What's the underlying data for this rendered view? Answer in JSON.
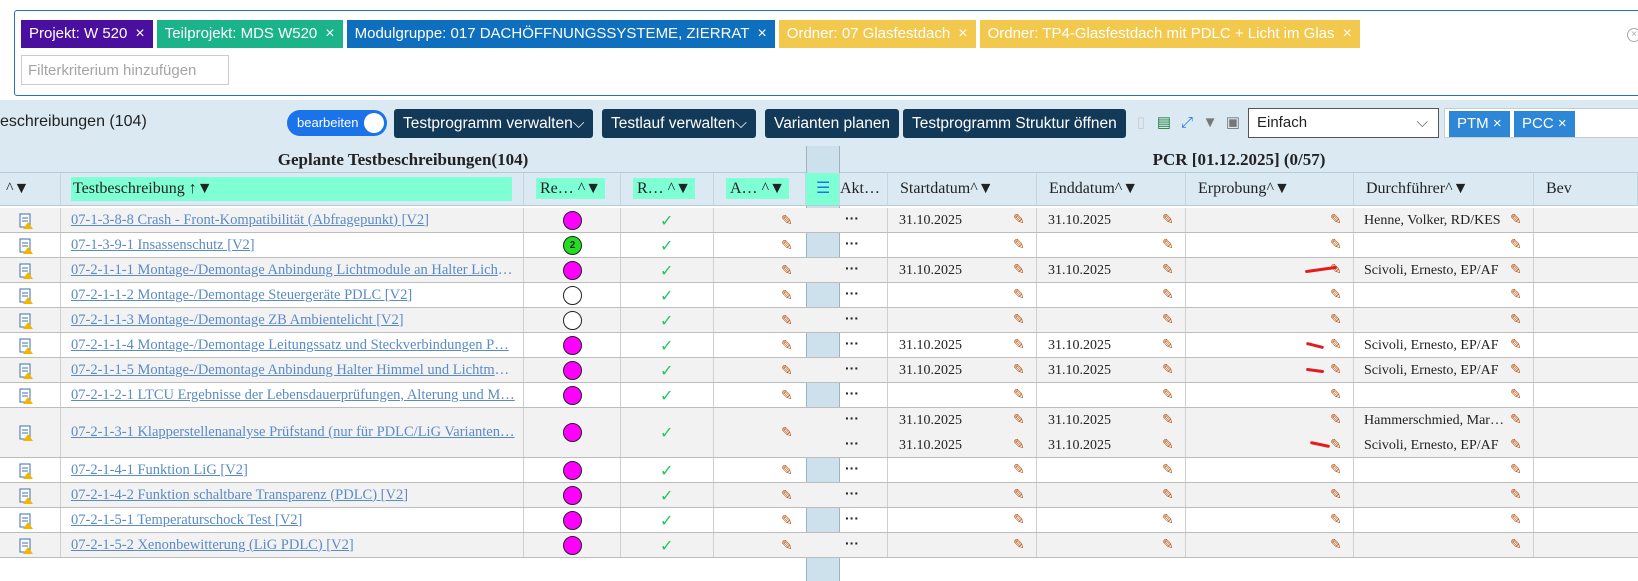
{
  "filters": {
    "chips": [
      {
        "label": "Projekt: W 520",
        "color": "#4b0fa0"
      },
      {
        "label": "Teilprojekt: MDS W520",
        "color": "#1bb38a"
      },
      {
        "label": "Modulgruppe: 017 DACHÖFFNUNGSSYSTEME, ZIERRAT",
        "color": "#0d6fbd"
      },
      {
        "label": "Ordner: 07 Glasfestdach",
        "color": "#f3c94d"
      },
      {
        "label": "Ordner: TP4-Glasfestdach mit PDLC + Licht im Glas",
        "color": "#f3c94d"
      }
    ],
    "remove_glyph": "×",
    "placeholder": "Filterkriterium hinzufügen"
  },
  "toolbar": {
    "title": "eschreibungen (104)",
    "toggle_label": "bearbeiten",
    "buttons": [
      "Testprogramm verwalten",
      "Testlauf verwalten",
      "Varianten planen",
      "Testprogramm Struktur öffnen"
    ],
    "select_value": "Einfach",
    "tags": [
      "PTM",
      "PCC"
    ]
  },
  "grid": {
    "group_left": "Geplante Testbeschreibungen(104)",
    "group_right": "PCR [01.12.2025] (0/57)",
    "columns_left": [
      "Testbeschreibung",
      "Re…",
      "R…",
      "A…"
    ],
    "columns_right": [
      "Akt…",
      "Startdatum",
      "Enddatum",
      "Erprobung",
      "Durchführer",
      "Bev"
    ],
    "rows": [
      {
        "name": "07-1-3-8-8 Crash - Front-Kompatibilität (Abfragepunkt) [V2]",
        "status": "magenta",
        "start": "31.10.2025",
        "end": "31.10.2025",
        "person": "Henne, Volker, RD/KES"
      },
      {
        "name": "07-1-3-9-1 Insassenschutz [V2]",
        "status": "green",
        "badge": "2",
        "start": "",
        "end": "",
        "person": ""
      },
      {
        "name": "07-2-1-1-1 Montage-/Demontage Anbindung Lichtmodule an Halter Licht…",
        "status": "magenta",
        "start": "31.10.2025",
        "end": "31.10.2025",
        "person": "Scivoli, Ernesto, EP/AF"
      },
      {
        "name": "07-2-1-1-2 Montage-/Demontage Steuergeräte PDLC [V2]",
        "status": "empty",
        "start": "",
        "end": "",
        "person": ""
      },
      {
        "name": "07-2-1-1-3 Montage-/Demontage ZB Ambientelicht [V2]",
        "status": "empty",
        "start": "",
        "end": "",
        "person": ""
      },
      {
        "name": "07-2-1-1-4 Montage-/Demontage Leitungssatz und Steckverbindungen P…",
        "status": "magenta",
        "start": "31.10.2025",
        "end": "31.10.2025",
        "person": "Scivoli, Ernesto, EP/AF"
      },
      {
        "name": "07-2-1-1-5 Montage-/Demontage Anbindung Halter Himmel und Lichtmo…",
        "status": "magenta",
        "start": "31.10.2025",
        "end": "31.10.2025",
        "person": "Scivoli, Ernesto, EP/AF"
      },
      {
        "name": "07-2-1-2-1 LTCU Ergebnisse der Lebensdauerprüfungen, Alterung und M…",
        "status": "magenta",
        "start": "",
        "end": "",
        "person": ""
      },
      {
        "name": "07-2-1-3-1 Klapperstellenanalyse Prüfstand (nur für PDLC/LiG Varianten…",
        "status": "magenta",
        "start": "31.10.2025",
        "end": "31.10.2025",
        "person": "Hammerschmied, Mar…",
        "start2": "31.10.2025",
        "end2": "31.10.2025",
        "person2": "Scivoli, Ernesto, EP/AF"
      },
      {
        "name": "07-2-1-4-1 Funktion LiG [V2]",
        "status": "magenta",
        "start": "",
        "end": "",
        "person": ""
      },
      {
        "name": "07-2-1-4-2 Funktion schaltbare Transparenz (PDLC) [V2]",
        "status": "magenta",
        "start": "",
        "end": "",
        "person": ""
      },
      {
        "name": "07-2-1-5-1 Temperaturschock Test [V2]",
        "status": "magenta",
        "start": "",
        "end": "",
        "person": ""
      },
      {
        "name": "07-2-1-5-2 Xenonbewitterung (LiG PDLC) [V2]",
        "status": "magenta",
        "start": "",
        "end": "",
        "person": ""
      }
    ]
  },
  "colors": {
    "magenta": "#ff00ff",
    "green": "#22dd22",
    "accent": "#123a58"
  }
}
